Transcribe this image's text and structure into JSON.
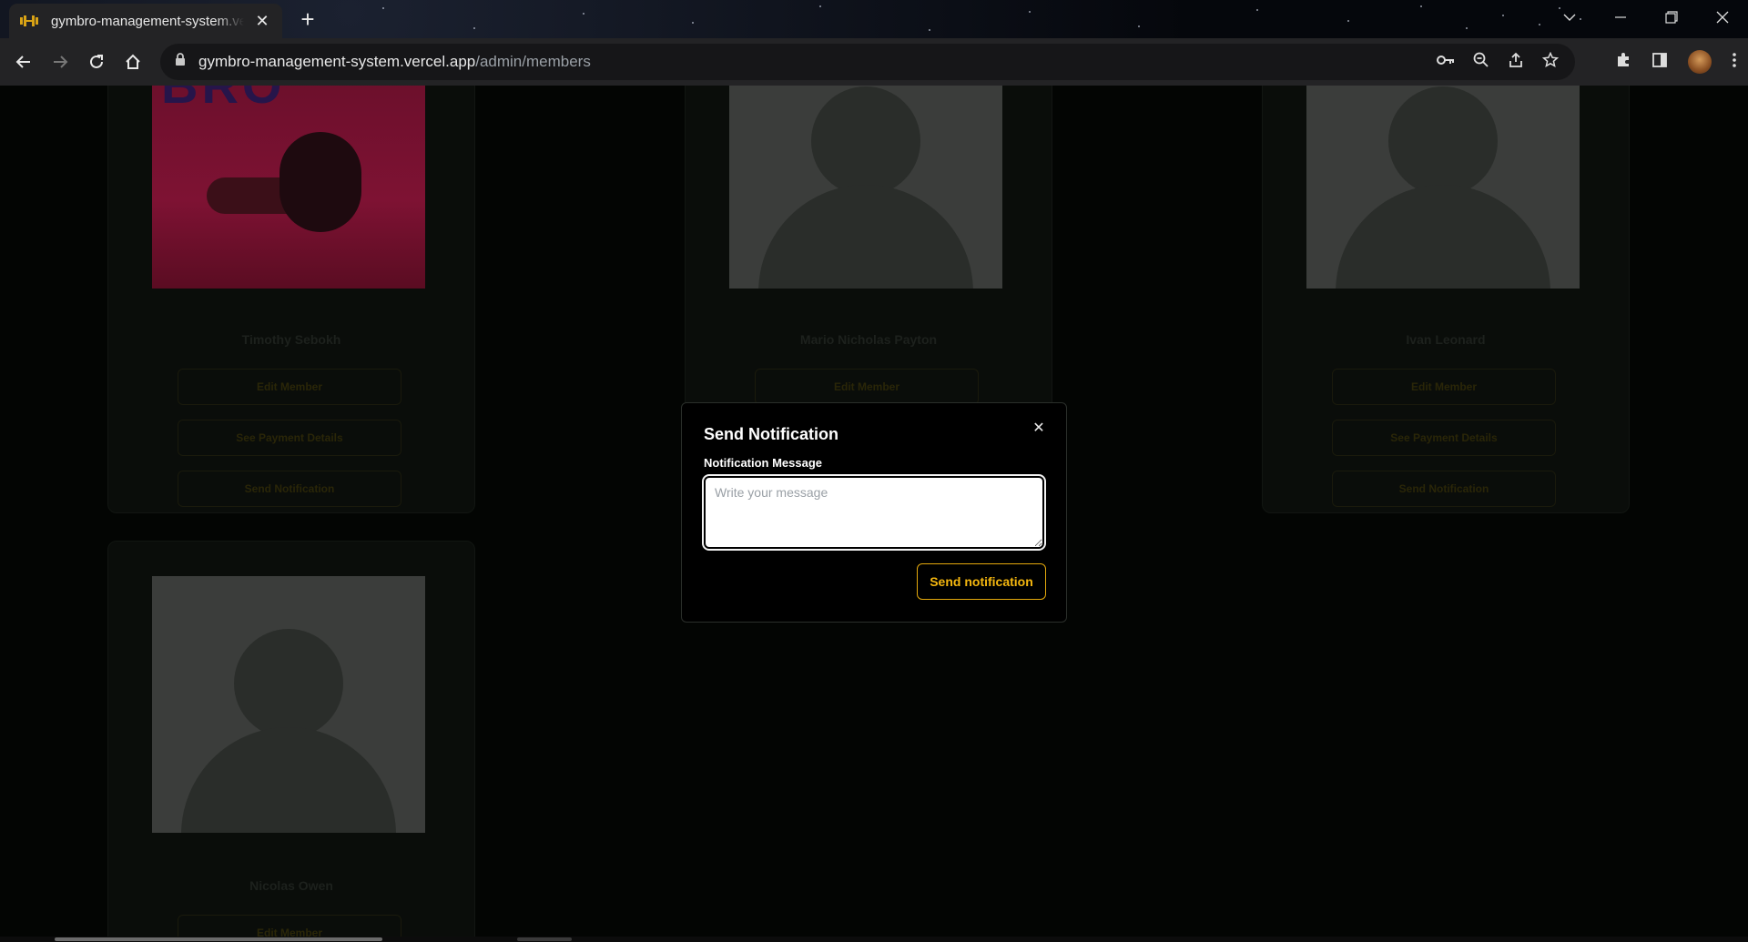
{
  "browser": {
    "tab_title": "gymbro-management-system.vercel.app",
    "url_host": "gymbro-management-system.vercel.app",
    "url_path": "/admin/members",
    "accent_color": "#f5b70f"
  },
  "members": [
    {
      "name": "Timothy Sebokh",
      "buttons": [
        "Edit Member",
        "See Payment Details",
        "Send Notification"
      ]
    },
    {
      "name": "Mario Nicholas Payton",
      "buttons": [
        "Edit Member"
      ]
    },
    {
      "name": "Ivan Leonard",
      "buttons": [
        "Edit Member",
        "See Payment Details",
        "Send Notification"
      ]
    },
    {
      "name": "Nicolas Owen",
      "buttons": [
        "Edit Member"
      ]
    }
  ],
  "modal": {
    "title": "Send Notification",
    "label": "Notification Message",
    "placeholder": "Write your message",
    "message_value": "",
    "submit_label": "Send notification",
    "close_glyph": "✕"
  }
}
